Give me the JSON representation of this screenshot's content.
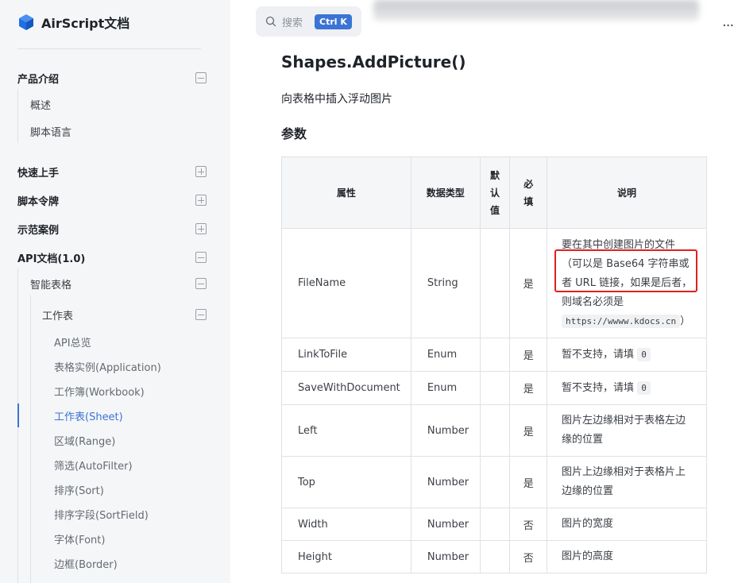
{
  "brand": {
    "title": "AirScript文档",
    "logo_icon": "cube-logo-icon",
    "accent": "#1f6fe5"
  },
  "sidebar": {
    "groups": [
      {
        "label": "产品介绍",
        "state": "expanded",
        "items": [
          "概述",
          "脚本语言"
        ]
      },
      {
        "label": "快速上手",
        "state": "collapsed"
      },
      {
        "label": "脚本令牌",
        "state": "collapsed"
      },
      {
        "label": "示范案例",
        "state": "collapsed"
      },
      {
        "label": "API文档(1.0)",
        "state": "expanded"
      }
    ],
    "api": {
      "smart_sheet": "智能表格",
      "worksheet": "工作表",
      "leaves": [
        "API总览",
        "表格实例(Application)",
        "工作簿(Workbook)",
        "工作表(Sheet)",
        "区域(Range)",
        "筛选(AutoFilter)",
        "排序(Sort)",
        "排序字段(SortField)",
        "字体(Font)",
        "边框(Border)"
      ],
      "active_leaf": "工作表(Sheet)"
    }
  },
  "search": {
    "placeholder": "搜索",
    "shortcut": "Ctrl K"
  },
  "header": {
    "more_icon": "more-horizontal-icon"
  },
  "doc": {
    "title": "Shapes.AddPicture()",
    "description": "向表格中插入浮动图片",
    "params_heading": "参数",
    "columns": [
      "属性",
      "数据类型",
      "默认值",
      "必填",
      "说明"
    ],
    "col_default_chars": [
      "默",
      "认",
      "值"
    ],
    "col_required_chars": [
      "必",
      "填"
    ],
    "rows": [
      {
        "name": "FileName",
        "type": "String",
        "default": "",
        "required": "是",
        "desc": "要在其中创建图片的文件（可以是 Base64 字符串或者 URL 链接，如果是后者，则域名必须是",
        "desc_code": "https://wwww.kdocs.cn",
        "desc_tail": "）"
      },
      {
        "name": "LinkToFile",
        "type": "Enum",
        "default": "",
        "required": "是",
        "desc": "暂不支持，请填",
        "desc_code": "0"
      },
      {
        "name": "SaveWithDocument",
        "type": "Enum",
        "default": "",
        "required": "是",
        "desc": "暂不支持，请填",
        "desc_code": "0"
      },
      {
        "name": "Left",
        "type": "Number",
        "default": "",
        "required": "是",
        "desc": "图片左边缘相对于表格左边缘的位置"
      },
      {
        "name": "Top",
        "type": "Number",
        "default": "",
        "required": "是",
        "desc": "图片上边缘相对于表格片上边缘的位置"
      },
      {
        "name": "Width",
        "type": "Number",
        "default": "",
        "required": "否",
        "desc": "图片的宽度"
      },
      {
        "name": "Height",
        "type": "Number",
        "default": "",
        "required": "否",
        "desc": "图片的高度"
      }
    ]
  },
  "colors": {
    "link_active": "#3b74d4",
    "annotation_box": "#e02020",
    "sidebar_bg": "#f5f6f7"
  }
}
